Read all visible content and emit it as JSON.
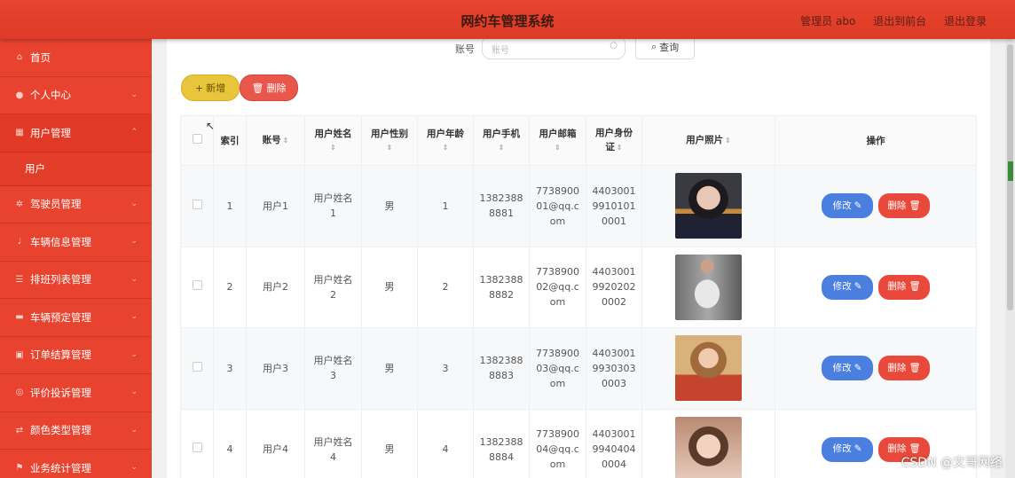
{
  "header": {
    "title": "网约车管理系统",
    "admin_label": "管理员 abo",
    "to_front": "退出到前台",
    "logout": "退出登录"
  },
  "sidebar": {
    "items": [
      {
        "label": "首页",
        "icon": "home-icon"
      },
      {
        "label": "个人中心",
        "icon": "user-icon"
      },
      {
        "label": "用户管理",
        "icon": "grid-icon"
      },
      {
        "label": "用户",
        "icon": ""
      },
      {
        "label": "驾驶员管理",
        "icon": "gear-icon"
      },
      {
        "label": "车辆信息管理",
        "icon": "mic-icon"
      },
      {
        "label": "排班列表管理",
        "icon": "list-icon"
      },
      {
        "label": "车辆预定管理",
        "icon": "monitor-icon"
      },
      {
        "label": "订单结算管理",
        "icon": "calendar-icon"
      },
      {
        "label": "评价投诉管理",
        "icon": "compass-icon"
      },
      {
        "label": "颜色类型管理",
        "icon": "shuffle-icon"
      },
      {
        "label": "业务统计管理",
        "icon": "flag-icon"
      }
    ]
  },
  "search": {
    "label": "账号",
    "placeholder": "账号",
    "button": "查询"
  },
  "toolbar": {
    "add": "新增",
    "delete": "删除"
  },
  "table": {
    "headers": {
      "index": "索引",
      "account": "账号",
      "name_1": "用户姓名",
      "gender": "用户性别",
      "age": "用户年龄",
      "phone": "用户手机",
      "email": "用户邮箱",
      "idcard_1": "用户身份",
      "idcard_2": "证",
      "photo": "用户照片",
      "ops": "操作"
    },
    "rows": [
      {
        "index": "1",
        "account": "用户1",
        "name_a": "用户姓名",
        "name_b": "1",
        "gender": "男",
        "age": "1",
        "phone_a": "1382388",
        "phone_b": "8881",
        "email_a": "7738900",
        "email_b": "01@qq.c",
        "email_c": "om",
        "id_a": "4403001",
        "id_b": "9910101",
        "id_c": "0001"
      },
      {
        "index": "2",
        "account": "用户2",
        "name_a": "用户姓名",
        "name_b": "2",
        "gender": "男",
        "age": "2",
        "phone_a": "1382388",
        "phone_b": "8882",
        "email_a": "7738900",
        "email_b": "02@qq.c",
        "email_c": "om",
        "id_a": "4403001",
        "id_b": "9920202",
        "id_c": "0002"
      },
      {
        "index": "3",
        "account": "用户3",
        "name_a": "用户姓名",
        "name_b": "3",
        "gender": "男",
        "age": "3",
        "phone_a": "1382388",
        "phone_b": "8883",
        "email_a": "7738900",
        "email_b": "03@qq.c",
        "email_c": "om",
        "id_a": "4403001",
        "id_b": "9930303",
        "id_c": "0003"
      },
      {
        "index": "4",
        "account": "用户4",
        "name_a": "用户姓名",
        "name_b": "4",
        "gender": "男",
        "age": "4",
        "phone_a": "1382388",
        "phone_b": "8884",
        "email_a": "7738900",
        "email_b": "04@qq.c",
        "email_c": "om",
        "id_a": "4403001",
        "id_b": "9940404",
        "id_c": "0004"
      }
    ],
    "edit_label": "修改",
    "delete_label": "删除"
  },
  "watermark": "CSDN @文哥网络",
  "colors": {
    "header": "#e8442f",
    "sidebar": "#e8432f",
    "add_button": "#e8c53a",
    "delete_button": "#e9564a",
    "edit_button": "#4a7fe0"
  }
}
